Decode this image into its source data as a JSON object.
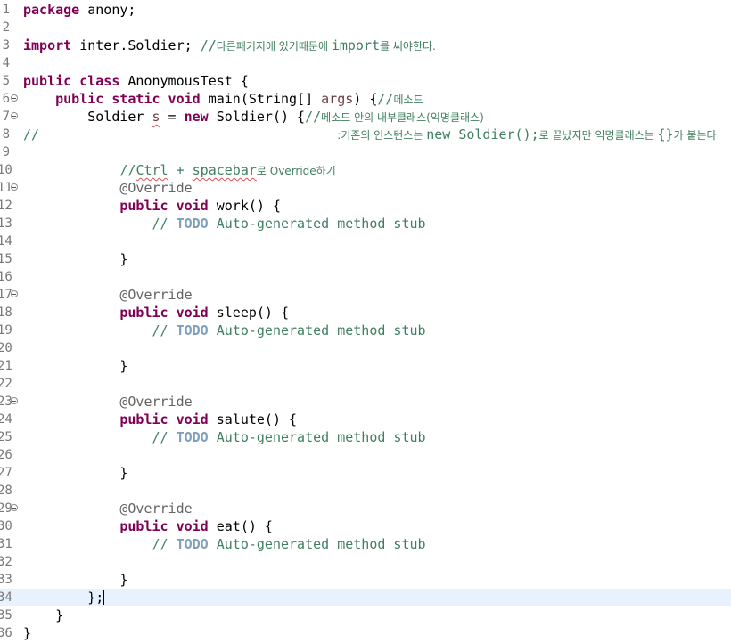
{
  "editor": {
    "current_line": 34,
    "lines": [
      {
        "n": "1",
        "fold": false
      },
      {
        "n": "2",
        "fold": false
      },
      {
        "n": "3",
        "fold": false
      },
      {
        "n": "4",
        "fold": false
      },
      {
        "n": "5",
        "fold": false
      },
      {
        "n": "6",
        "fold": true
      },
      {
        "n": "7",
        "fold": true
      },
      {
        "n": "8",
        "fold": false
      },
      {
        "n": "9",
        "fold": false
      },
      {
        "n": "10",
        "fold": false
      },
      {
        "n": "11",
        "fold": true
      },
      {
        "n": "12",
        "fold": false
      },
      {
        "n": "13",
        "fold": false
      },
      {
        "n": "14",
        "fold": false
      },
      {
        "n": "15",
        "fold": false
      },
      {
        "n": "16",
        "fold": false
      },
      {
        "n": "17",
        "fold": true
      },
      {
        "n": "18",
        "fold": false
      },
      {
        "n": "19",
        "fold": false
      },
      {
        "n": "20",
        "fold": false
      },
      {
        "n": "21",
        "fold": false
      },
      {
        "n": "22",
        "fold": false
      },
      {
        "n": "23",
        "fold": true
      },
      {
        "n": "24",
        "fold": false
      },
      {
        "n": "25",
        "fold": false
      },
      {
        "n": "26",
        "fold": false
      },
      {
        "n": "27",
        "fold": false
      },
      {
        "n": "28",
        "fold": false
      },
      {
        "n": "29",
        "fold": true
      },
      {
        "n": "30",
        "fold": false
      },
      {
        "n": "31",
        "fold": false
      },
      {
        "n": "32",
        "fold": false
      },
      {
        "n": "33",
        "fold": false
      },
      {
        "n": "34",
        "fold": false
      },
      {
        "n": "35",
        "fold": false
      },
      {
        "n": "36",
        "fold": false
      }
    ]
  },
  "code": {
    "l1_kw": "package",
    "l1_rest": " anony;",
    "l3_kw": "import",
    "l3_rest": " inter.Soldier; ",
    "l3_cm1": "//",
    "l3_ko1": "다른패키지에 있기때문에 ",
    "l3_cm2": "import",
    "l3_ko2": "를 써야한다.",
    "l5_kw": "public class",
    "l5_rest": " AnonymousTest {",
    "l6_indent": "    ",
    "l6_kw": "public static void",
    "l6_rest1": " main(String[] ",
    "l6_var": "args",
    "l6_rest2": ") {",
    "l6_cm": "//",
    "l6_ko": "메소드",
    "l7_indent": "        ",
    "l7_rest1": "Soldier ",
    "l7_var": "s",
    "l7_rest2": " = ",
    "l7_kw": "new",
    "l7_rest3": " Soldier() {",
    "l7_cm": "//",
    "l7_ko": "메소드 안의 내부클래스(익명클래스)",
    "l8_cm": "//",
    "l8_pad": "                                     ",
    "l8_ko1": ":기존의 인스턴스는 ",
    "l8_code": "new Soldier();",
    "l8_ko2": "로 끝났지만 익명클래스는 ",
    "l8_braces": "{}",
    "l8_ko3": "가 붙는다",
    "l10_indent": "            ",
    "l10_cm1": "//",
    "l10_sq1": "Ctrl",
    "l10_cm2": " + ",
    "l10_sq2": "spacebar",
    "l10_ko": "로 Override하기",
    "ind12": "            ",
    "ind16": "                ",
    "annotation": "@Override",
    "kw_public_void": "public void",
    "m1": " work() {",
    "m2": " sleep() {",
    "m3": " salute() {",
    "m4": " eat() {",
    "stub_pre": "// ",
    "stub_todo": "TODO",
    "stub_post": " Auto-generated method stub",
    "close_brace": "}",
    "l34_indent": "        ",
    "l34_text": "};",
    "l35_indent": "    ",
    "l35_text": "}",
    "l36_text": "}"
  }
}
